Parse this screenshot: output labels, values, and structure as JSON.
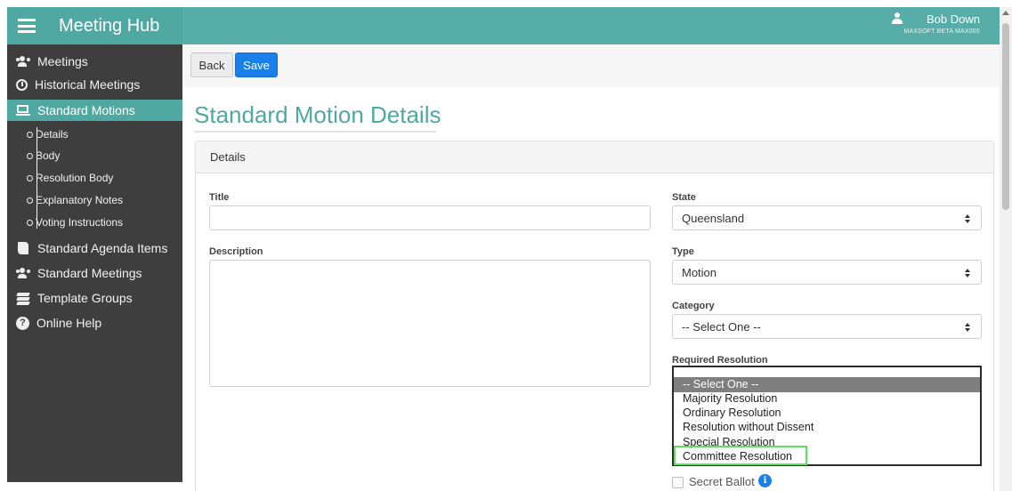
{
  "app": {
    "title": "Meeting Hub",
    "header_color": "#4fa8a2"
  },
  "user": {
    "name": "Bob Down",
    "org": "MAXSOFT BETA MAX005",
    "icon": "user-icon"
  },
  "sidebar": {
    "items": [
      {
        "label": "Meetings",
        "icon": "users-icon"
      },
      {
        "label": "Historical Meetings",
        "icon": "history-icon"
      },
      {
        "label": "Standard Motions",
        "icon": "board-icon",
        "active": true
      },
      {
        "label": "Standard Agenda Items",
        "icon": "scroll-icon"
      },
      {
        "label": "Standard Meetings",
        "icon": "group-icon"
      },
      {
        "label": "Template Groups",
        "icon": "layers-icon"
      },
      {
        "label": "Online Help",
        "icon": "help-icon"
      }
    ],
    "subitems": [
      "Details",
      "Body",
      "Resolution Body",
      "Explanatory Notes",
      "Voting Instructions"
    ]
  },
  "toolbar": {
    "back_label": "Back",
    "save_label": "Save"
  },
  "page": {
    "title": "Standard Motion Details"
  },
  "panel": {
    "heading": "Details",
    "title_label": "Title",
    "title_value": "",
    "description_label": "Description",
    "description_value": "",
    "state_label": "State",
    "state_value": "Queensland",
    "type_label": "Type",
    "type_value": "Motion",
    "category_label": "Category",
    "category_value": "-- Select One --",
    "required_resolution_label": "Required Resolution",
    "required_resolution_options": [
      "-- Select One --",
      "Majority Resolution",
      "Ordinary Resolution",
      "Resolution without Dissent",
      "Special Resolution",
      "Committee Resolution"
    ],
    "secret_ballot_label": "Secret Ballot"
  }
}
